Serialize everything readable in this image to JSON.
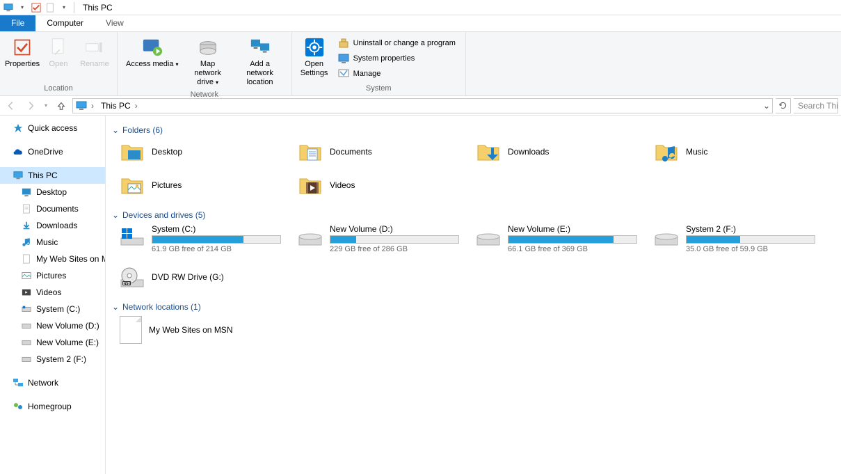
{
  "window": {
    "title": "This PC"
  },
  "ribbon_tabs": {
    "file": "File",
    "computer": "Computer",
    "view": "View"
  },
  "ribbon": {
    "location": {
      "group_label": "Location",
      "properties": "Properties",
      "open": "Open",
      "rename": "Rename"
    },
    "network": {
      "group_label": "Network",
      "access_media": "Access media",
      "map_drive": "Map network drive",
      "add_location": "Add a network location"
    },
    "settings": {
      "open_settings": "Open Settings"
    },
    "system": {
      "group_label": "System",
      "uninstall": "Uninstall or change a program",
      "sys_props": "System properties",
      "manage": "Manage"
    }
  },
  "addr": {
    "this_pc": "This PC",
    "search_placeholder": "Search Thi"
  },
  "nav": {
    "quick_access": "Quick access",
    "onedrive": "OneDrive",
    "this_pc": "This PC",
    "desktop": "Desktop",
    "documents": "Documents",
    "downloads": "Downloads",
    "music": "Music",
    "myweb": "My Web Sites on M",
    "pictures": "Pictures",
    "videos": "Videos",
    "sysc": "System (C:)",
    "vold": "New Volume (D:)",
    "vole": "New Volume (E:)",
    "sys2": "System 2 (F:)",
    "network": "Network",
    "homegroup": "Homegroup"
  },
  "groups": {
    "folders_header": "Folders (6)",
    "drives_header": "Devices and drives (5)",
    "netloc_header": "Network locations (1)"
  },
  "folders": {
    "desktop": "Desktop",
    "documents": "Documents",
    "downloads": "Downloads",
    "music": "Music",
    "pictures": "Pictures",
    "videos": "Videos"
  },
  "drives": {
    "c": {
      "name": "System (C:)",
      "free": "61.9 GB free of 214 GB",
      "pct": 71
    },
    "d": {
      "name": "New Volume (D:)",
      "free": "229 GB free of 286 GB",
      "pct": 20
    },
    "e": {
      "name": "New Volume (E:)",
      "free": "66.1 GB free of 369 GB",
      "pct": 82
    },
    "f": {
      "name": "System 2 (F:)",
      "free": "35.0 GB free of 59.9 GB",
      "pct": 42
    },
    "g": {
      "name": "DVD RW Drive (G:)"
    }
  },
  "netloc": {
    "msn": "My Web Sites on MSN"
  }
}
